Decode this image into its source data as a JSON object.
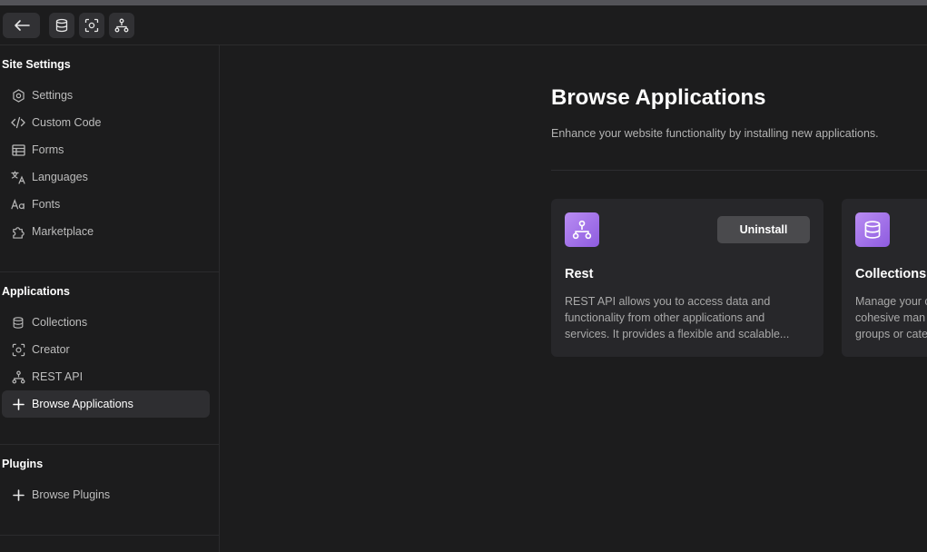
{
  "sidebar": {
    "sections": [
      {
        "title": "Site Settings",
        "items": [
          {
            "label": "Settings",
            "icon": "gear-icon"
          },
          {
            "label": "Custom Code",
            "icon": "code-icon"
          },
          {
            "label": "Forms",
            "icon": "table-icon"
          },
          {
            "label": "Languages",
            "icon": "translate-icon"
          },
          {
            "label": "Fonts",
            "icon": "font-icon"
          },
          {
            "label": "Marketplace",
            "icon": "puzzle-icon"
          }
        ]
      },
      {
        "title": "Applications",
        "items": [
          {
            "label": "Collections",
            "icon": "database-icon"
          },
          {
            "label": "Creator",
            "icon": "scan-icon"
          },
          {
            "label": "REST API",
            "icon": "network-icon"
          },
          {
            "label": "Browse Applications",
            "icon": "plus-icon",
            "active": true
          }
        ]
      },
      {
        "title": "Plugins",
        "items": [
          {
            "label": "Browse Plugins",
            "icon": "plus-icon"
          }
        ]
      }
    ]
  },
  "main": {
    "title": "Browse Applications",
    "subtitle": "Enhance your website functionality by installing new applications.",
    "cards": [
      {
        "title": "Rest",
        "icon": "network-icon",
        "button": "Uninstall",
        "description_lines": [
          "REST API allows you to access data and",
          "functionality from other applications and",
          "services. It provides a flexible and scalable..."
        ]
      },
      {
        "title": "Collections",
        "icon": "database-icon",
        "description_lines": [
          "Manage your c",
          "cohesive man",
          "groups or cate"
        ]
      }
    ]
  },
  "colors": {
    "background": "#1c1c1d",
    "card": "#27272a",
    "accent": "#9f6fea",
    "active_item": "#2e2e31"
  }
}
